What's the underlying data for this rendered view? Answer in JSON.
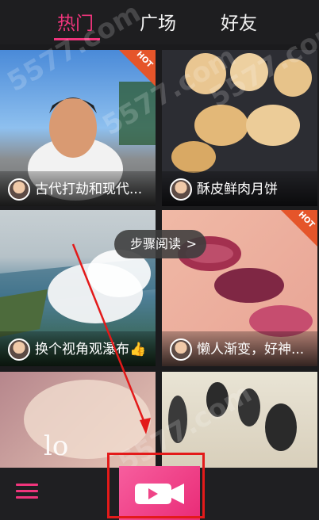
{
  "tabs": [
    {
      "label": "热门"
    },
    {
      "label": "广场"
    },
    {
      "label": "好友"
    }
  ],
  "feed": [
    {
      "title": "古代打劫和现代...",
      "hot": true
    },
    {
      "title": "酥皮鲜肉月饼",
      "hot": false
    },
    {
      "title": "换个视角观瀑布👍",
      "hot": false
    },
    {
      "title": "懒人渐变，好神...",
      "hot": true
    },
    {
      "title": "",
      "hot": false
    },
    {
      "title": "",
      "hot": false
    }
  ],
  "hot_label": "HOT",
  "tooltip": {
    "text": "步骤阅读",
    "chevron": ">"
  },
  "watermark": "5577.com",
  "colors": {
    "accent": "#f0357c",
    "highlight_box": "#e31a1a",
    "hot_badge": "#e5552a"
  },
  "icons": {
    "menu": "menu-icon",
    "record": "video-camera-icon"
  }
}
